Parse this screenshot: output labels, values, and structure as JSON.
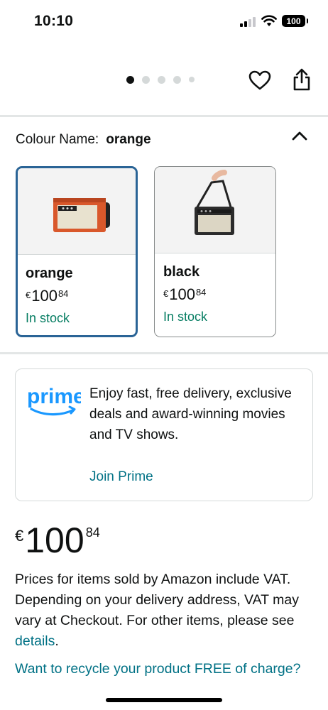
{
  "status_bar": {
    "time": "10:10",
    "battery": "100"
  },
  "gallery": {
    "dots_total": 5,
    "active_index": 0
  },
  "colour": {
    "label": "Colour Name:",
    "selected": "orange",
    "options": [
      {
        "name": "orange",
        "currency": "€",
        "price_whole": "100",
        "price_fraction": "84",
        "stock": "In stock",
        "color": "#d9582b"
      },
      {
        "name": "black",
        "currency": "€",
        "price_whole": "100",
        "price_fraction": "84",
        "stock": "In stock",
        "color": "#2b2b2b"
      }
    ]
  },
  "prime": {
    "logo_text": "prime",
    "text": "Enjoy fast, free delivery, exclusive deals and award-winning movies and TV shows.",
    "join_label": "Join Prime"
  },
  "price": {
    "currency": "€",
    "whole": "100",
    "fraction": "84"
  },
  "vat": {
    "text": "Prices for items sold by Amazon include VAT. Depending on your delivery address, VAT may vary at Checkout. For other items, please see",
    "link": "details",
    "end": "."
  },
  "recycle_link": "Want to recycle your product FREE of charge?",
  "colors": {
    "link": "#007185",
    "stock_green": "#067d62",
    "selected_border": "#2a6496",
    "prime_blue": "#1a98ff"
  },
  "icons": [
    "heart-icon",
    "share-icon",
    "chevron-up-icon",
    "wifi-icon",
    "signal-icon",
    "battery-icon"
  ]
}
